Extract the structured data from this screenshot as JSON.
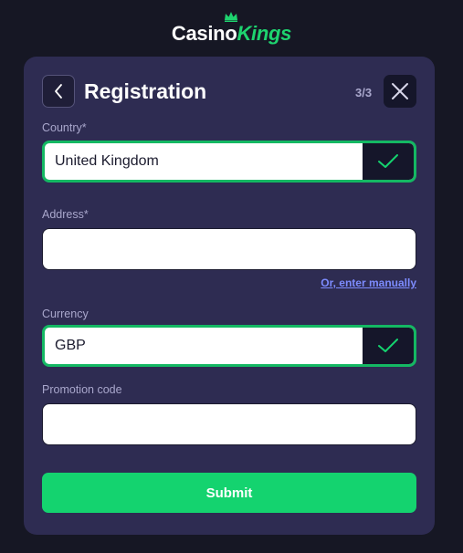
{
  "brand": {
    "name_part1": "Casino",
    "name_part2": "Kings",
    "accent_color": "#1ed36f"
  },
  "header": {
    "title": "Registration",
    "step": "3/3",
    "back_icon": "chevron-left-icon",
    "close_icon": "close-icon"
  },
  "form": {
    "country": {
      "label": "Country*",
      "value": "United Kingdom",
      "status_icon": "check-icon"
    },
    "address": {
      "label": "Address*",
      "value": "",
      "manual_link": "Or, enter manually"
    },
    "currency": {
      "label": "Currency",
      "value": "GBP",
      "status_icon": "check-icon"
    },
    "promo": {
      "label": "Promotion code",
      "value": ""
    },
    "submit_label": "Submit"
  },
  "colors": {
    "background": "#161724",
    "card": "#2e2c52",
    "success": "#14d36f",
    "link": "#7d8cff"
  }
}
